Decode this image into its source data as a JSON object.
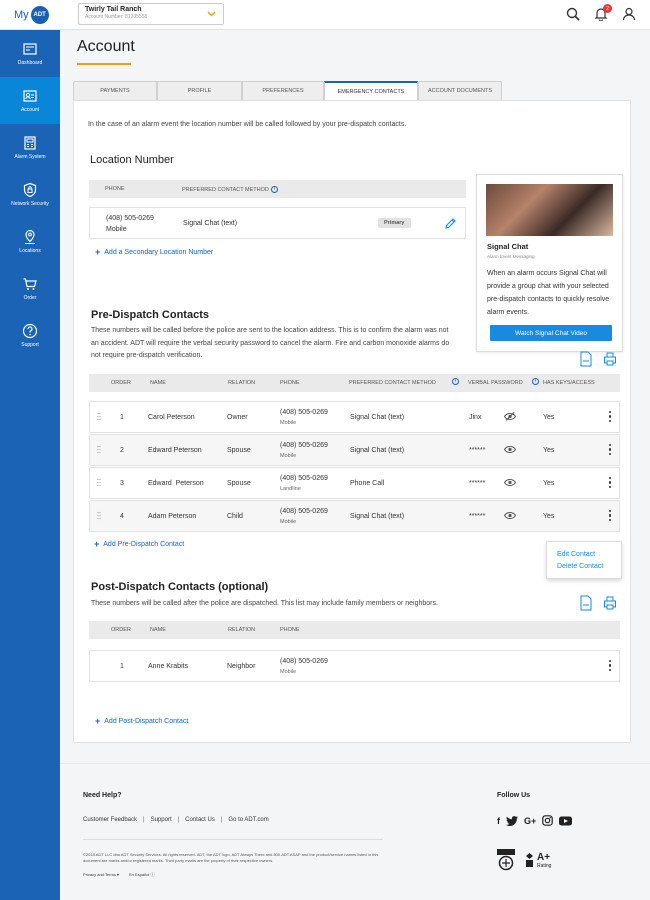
{
  "header": {
    "logo_my": "My",
    "logo_brand": "ADT",
    "account_name": "Twirly Tail Ranch",
    "account_number": "Account Number: 81235558",
    "notifications_count": "2"
  },
  "sidebar": {
    "items": [
      {
        "label": "Dashboard",
        "icon": "dashboard-icon"
      },
      {
        "label": "Account",
        "icon": "account-icon"
      },
      {
        "label": "Alarm System",
        "icon": "alarm-panel-icon"
      },
      {
        "label": "Network Security",
        "icon": "shield-icon"
      },
      {
        "label": "Locations",
        "icon": "location-icon"
      },
      {
        "label": "Order",
        "icon": "cart-icon"
      },
      {
        "label": "Support",
        "icon": "help-icon"
      }
    ]
  },
  "page": {
    "title": "Account",
    "tabs": [
      "Payments",
      "Profile",
      "Preferences",
      "Emergency Contacts",
      "Account Documents"
    ],
    "intro": "In the case of an alarm event the location number will be called followed by your pre-dispatch contacts."
  },
  "location": {
    "title": "Location Number",
    "headers": {
      "phone": "Phone",
      "method": "Preferred Contact Method"
    },
    "row": {
      "phone": "(408) 505-0269",
      "type": "Mobile",
      "method": "Signal Chat (text)",
      "badge": "Primary"
    },
    "add_label": "Add a Secondary Location Number"
  },
  "signal_chat": {
    "title": "Signal Chat",
    "subtitle": "Alarm Event Messaging",
    "body": "When an alarm occurs Signal Chat will provide a group chat with your selected pre-dispatch contacts to quickly resolve alarm events.",
    "button": "Watch Signal Chat Video"
  },
  "pre_dispatch": {
    "title": "Pre-Dispatch Contacts",
    "desc": "These numbers will be called before the police are sent to the location address. This is to confirm the alarm was not an accident. ADT will require the verbal security password to cancel the alarm. Fire and carbon monoxide alarms do not require pre-dispatch verification.",
    "headers": {
      "order": "Order",
      "name": "Name",
      "relation": "Relation",
      "phone": "Phone",
      "method": "Preferred Contact Method",
      "password": "Verbal Password",
      "keys": "Has Keys/Access"
    },
    "rows": [
      {
        "order": "1",
        "name": "Carol Peterson",
        "relation": "Owner",
        "phone": "(408) 505-0269",
        "type": "Mobile",
        "method": "Signal Chat (text)",
        "password": "Jinx",
        "keys": "Yes"
      },
      {
        "order": "2",
        "name": "Edward Peterson",
        "relation": "Spouse",
        "phone": "(408) 505-0269",
        "type": "Mobile",
        "method": "Signal Chat (text)",
        "password": "******",
        "keys": "Yes"
      },
      {
        "order": "3",
        "name": "Edward  Peterson",
        "relation": "Spouse",
        "phone": "(408) 505-0269",
        "type": "Landline",
        "method": "Phone Call",
        "password": "******",
        "keys": "Yes"
      },
      {
        "order": "4",
        "name": "Adam Peterson",
        "relation": "Child",
        "phone": "(408) 505-0269",
        "type": "Mobile",
        "method": "Signal Chat (text)",
        "password": "******",
        "keys": "Yes"
      }
    ],
    "add_label": "Add Pre-Dispatch Contact",
    "menu": {
      "edit": "Edit Contact",
      "delete": "Delete Contact"
    }
  },
  "post_dispatch": {
    "title": "Post-Dispatch Contacts (optional)",
    "desc": "These numbers will be called after the police are dispatched. This list may include family members or neighbors.",
    "headers": {
      "order": "Order",
      "name": "Name",
      "relation": "Relation",
      "phone": "Phone"
    },
    "rows": [
      {
        "order": "1",
        "name": "Anne Krabits",
        "relation": "Neighbor",
        "phone": "(408) 505-0269",
        "type": "Mobile"
      }
    ],
    "add_label": "Add Post-Dispatch Contact"
  },
  "footer": {
    "help_title": "Need Help?",
    "links": [
      "Customer Feedback",
      "Support",
      "Contact Us",
      "Go to ADT.com"
    ],
    "legal": "©2018 ADT LLC dba ADT Security Services. All rights reserved. ADT, the ADT logo, ADT Always There and 800.ADT.ASAP and the product/service names listed in this document are marks and/or registered marks. Third party marks are the property of their respective owners.",
    "privacy": "Privacy and Terms ▾",
    "spanish": "En Español ⓘ",
    "follow_title": "Follow Us",
    "social": [
      "f",
      "G+"
    ],
    "rating": "A+",
    "rating_label": "Rating"
  }
}
